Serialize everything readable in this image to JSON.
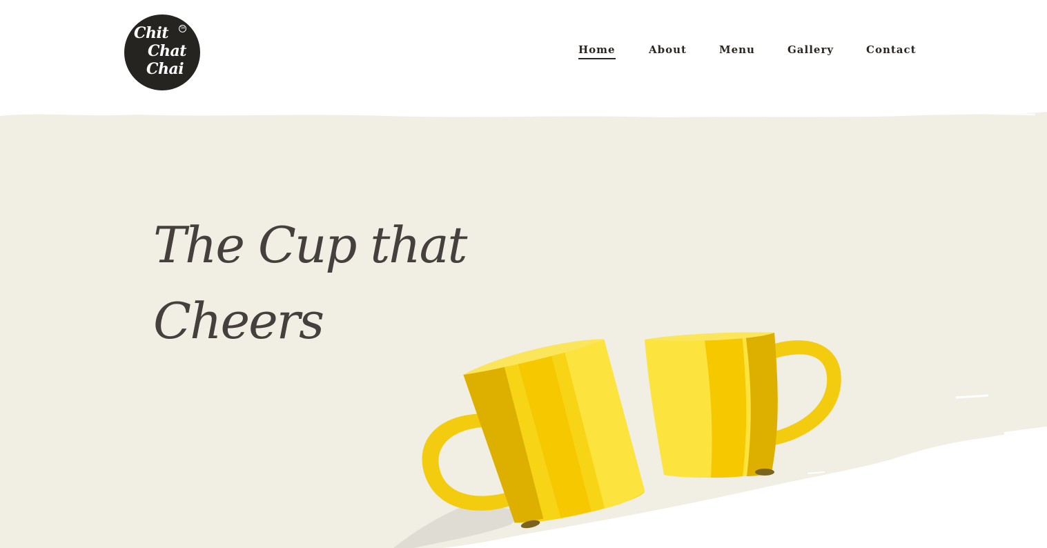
{
  "logo": {
    "line1": "Chit",
    "line2": "Chat",
    "line3": "Chai",
    "trademark": "TM"
  },
  "nav": {
    "items": [
      {
        "label": "Home",
        "active": true
      },
      {
        "label": "About",
        "active": false
      },
      {
        "label": "Menu",
        "active": false
      },
      {
        "label": "Gallery",
        "active": false
      },
      {
        "label": "Contact",
        "active": false
      }
    ]
  },
  "hero": {
    "title_line1": "The Cup that",
    "title_line2": "Cheers",
    "illustration": "two-yellow-mugs-icon"
  },
  "colors": {
    "hero_background": "#f1eee4",
    "text_dark": "#2b2522",
    "title_color": "#45403d",
    "logo_background": "#262421",
    "mug_yellow": "#f5cf00"
  }
}
